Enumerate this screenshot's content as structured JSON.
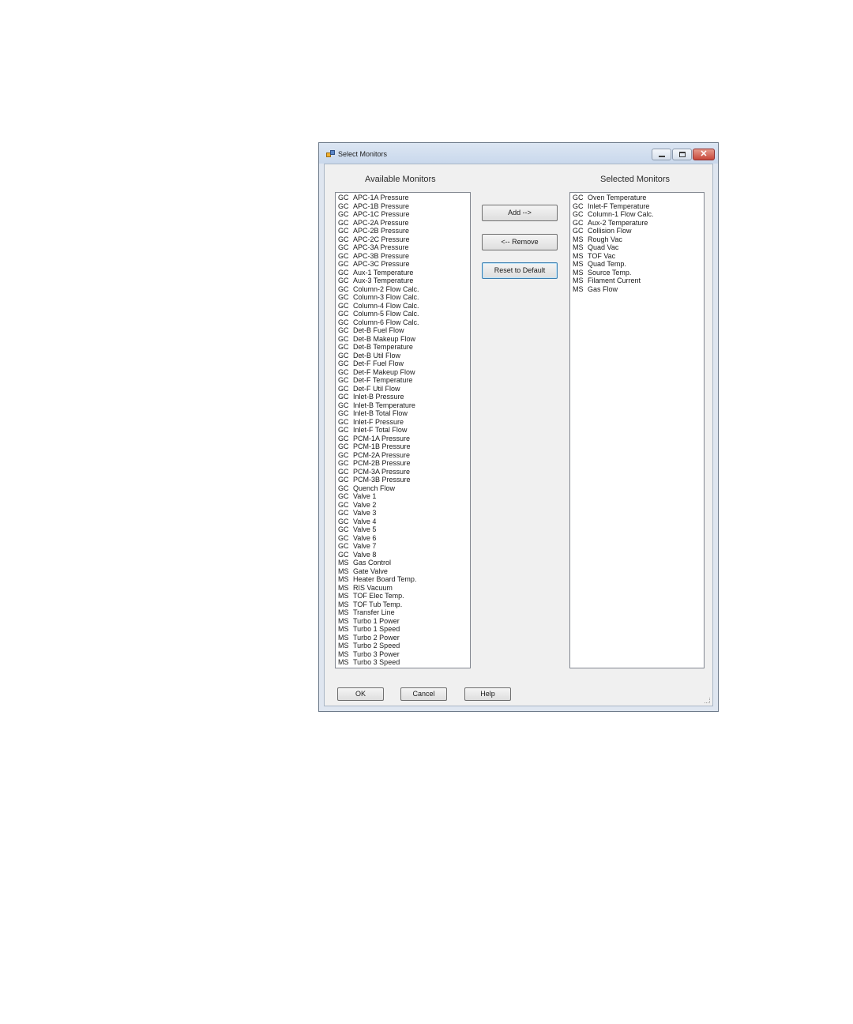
{
  "window": {
    "title": "Select Monitors"
  },
  "labels": {
    "available": "Available Monitors",
    "selected": "Selected Monitors"
  },
  "buttons": {
    "add": "Add -->",
    "remove": "<-- Remove",
    "reset": "Reset to Default",
    "ok": "OK",
    "cancel": "Cancel",
    "help": "Help"
  },
  "available": [
    {
      "group": "GC",
      "name": "APC-1A Pressure"
    },
    {
      "group": "GC",
      "name": "APC-1B Pressure"
    },
    {
      "group": "GC",
      "name": "APC-1C Pressure"
    },
    {
      "group": "GC",
      "name": "APC-2A Pressure"
    },
    {
      "group": "GC",
      "name": "APC-2B Pressure"
    },
    {
      "group": "GC",
      "name": "APC-2C Pressure"
    },
    {
      "group": "GC",
      "name": "APC-3A Pressure"
    },
    {
      "group": "GC",
      "name": "APC-3B Pressure"
    },
    {
      "group": "GC",
      "name": "APC-3C Pressure"
    },
    {
      "group": "GC",
      "name": "Aux-1 Temperature"
    },
    {
      "group": "GC",
      "name": "Aux-3 Temperature"
    },
    {
      "group": "GC",
      "name": "Column-2 Flow Calc."
    },
    {
      "group": "GC",
      "name": "Column-3 Flow Calc."
    },
    {
      "group": "GC",
      "name": "Column-4 Flow Calc."
    },
    {
      "group": "GC",
      "name": "Column-5 Flow Calc."
    },
    {
      "group": "GC",
      "name": "Column-6 Flow Calc."
    },
    {
      "group": "GC",
      "name": "Det-B Fuel Flow"
    },
    {
      "group": "GC",
      "name": "Det-B Makeup Flow"
    },
    {
      "group": "GC",
      "name": "Det-B Temperature"
    },
    {
      "group": "GC",
      "name": "Det-B Util Flow"
    },
    {
      "group": "GC",
      "name": "Det-F Fuel Flow"
    },
    {
      "group": "GC",
      "name": "Det-F Makeup Flow"
    },
    {
      "group": "GC",
      "name": "Det-F Temperature"
    },
    {
      "group": "GC",
      "name": "Det-F Util Flow"
    },
    {
      "group": "GC",
      "name": "Inlet-B Pressure"
    },
    {
      "group": "GC",
      "name": "Inlet-B Temperature"
    },
    {
      "group": "GC",
      "name": "Inlet-B Total Flow"
    },
    {
      "group": "GC",
      "name": "Inlet-F Pressure"
    },
    {
      "group": "GC",
      "name": "Inlet-F Total Flow"
    },
    {
      "group": "GC",
      "name": "PCM-1A Pressure"
    },
    {
      "group": "GC",
      "name": "PCM-1B Pressure"
    },
    {
      "group": "GC",
      "name": "PCM-2A Pressure"
    },
    {
      "group": "GC",
      "name": "PCM-2B Pressure"
    },
    {
      "group": "GC",
      "name": "PCM-3A Pressure"
    },
    {
      "group": "GC",
      "name": "PCM-3B Pressure"
    },
    {
      "group": "GC",
      "name": "Quench Flow"
    },
    {
      "group": "GC",
      "name": "Valve 1"
    },
    {
      "group": "GC",
      "name": "Valve 2"
    },
    {
      "group": "GC",
      "name": "Valve 3"
    },
    {
      "group": "GC",
      "name": "Valve 4"
    },
    {
      "group": "GC",
      "name": "Valve 5"
    },
    {
      "group": "GC",
      "name": "Valve 6"
    },
    {
      "group": "GC",
      "name": "Valve 7"
    },
    {
      "group": "GC",
      "name": "Valve 8"
    },
    {
      "group": "MS",
      "name": "Gas Control"
    },
    {
      "group": "MS",
      "name": "Gate Valve"
    },
    {
      "group": "MS",
      "name": "Heater Board Temp."
    },
    {
      "group": "MS",
      "name": "RIS Vacuum"
    },
    {
      "group": "MS",
      "name": "TOF Elec Temp."
    },
    {
      "group": "MS",
      "name": "TOF Tub Temp."
    },
    {
      "group": "MS",
      "name": "Transfer Line"
    },
    {
      "group": "MS",
      "name": "Turbo 1 Power"
    },
    {
      "group": "MS",
      "name": "Turbo 1 Speed"
    },
    {
      "group": "MS",
      "name": "Turbo 2 Power"
    },
    {
      "group": "MS",
      "name": "Turbo 2 Speed"
    },
    {
      "group": "MS",
      "name": "Turbo 3 Power"
    },
    {
      "group": "MS",
      "name": "Turbo 3 Speed"
    }
  ],
  "selected": [
    {
      "group": "GC",
      "name": "Oven Temperature"
    },
    {
      "group": "GC",
      "name": "Inlet-F Temperature"
    },
    {
      "group": "GC",
      "name": "Column-1 Flow Calc."
    },
    {
      "group": "GC",
      "name": "Aux-2 Temperature"
    },
    {
      "group": "GC",
      "name": "Collision Flow"
    },
    {
      "group": "MS",
      "name": "Rough Vac"
    },
    {
      "group": "MS",
      "name": "Quad Vac"
    },
    {
      "group": "MS",
      "name": "TOF Vac"
    },
    {
      "group": "MS",
      "name": "Quad Temp."
    },
    {
      "group": "MS",
      "name": "Source Temp."
    },
    {
      "group": "MS",
      "name": "Filament Current"
    },
    {
      "group": "MS",
      "name": "Gas Flow"
    }
  ]
}
